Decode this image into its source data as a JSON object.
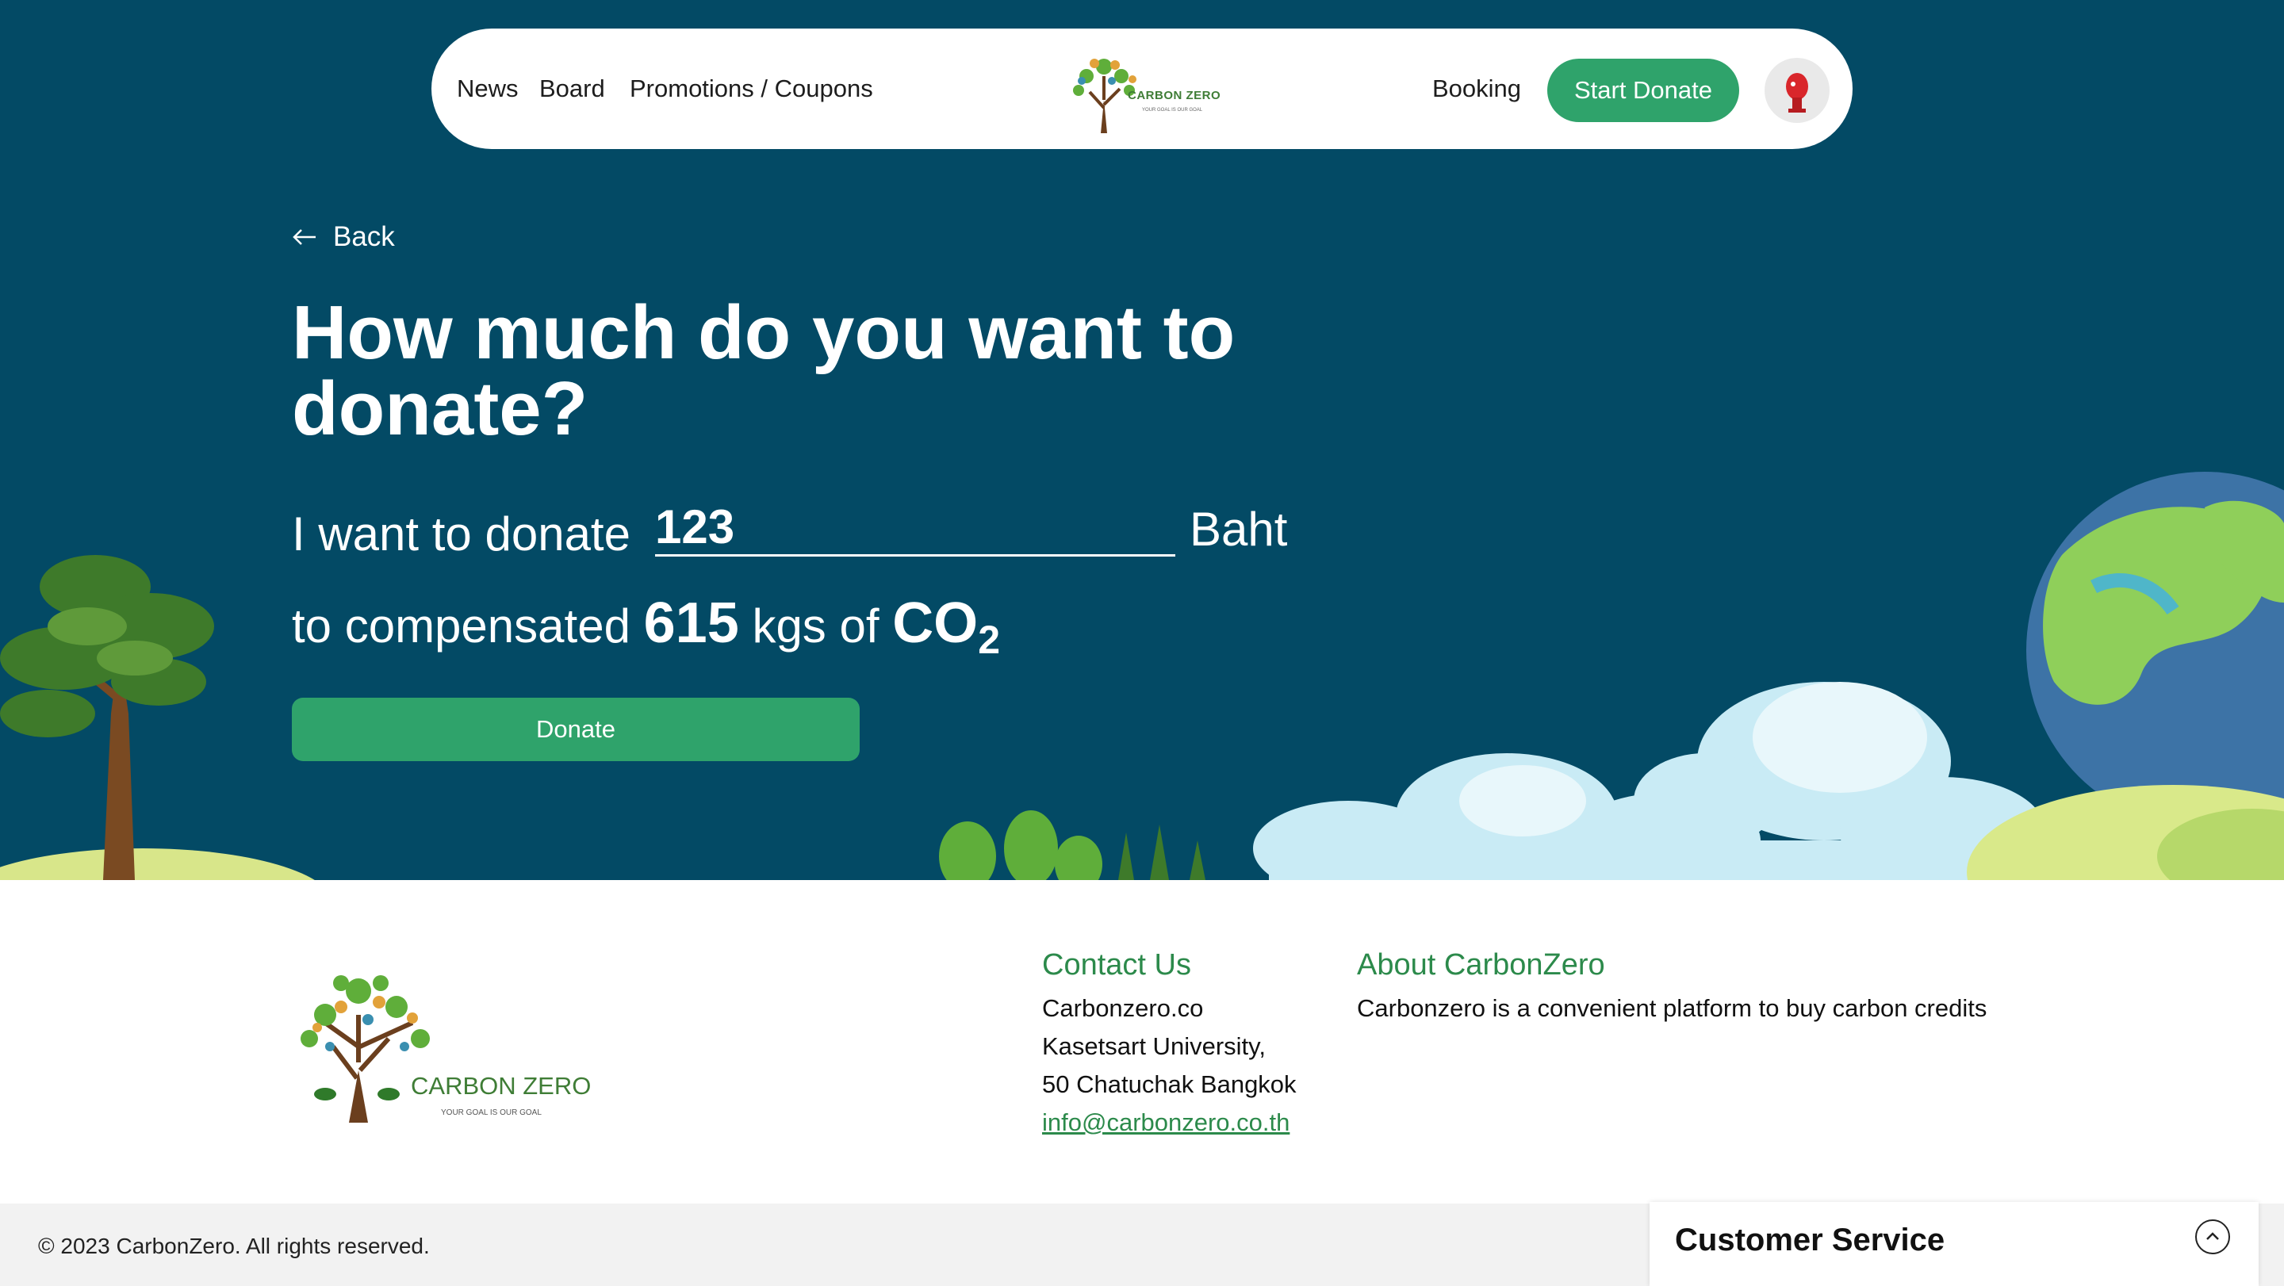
{
  "nav": {
    "links": [
      "News",
      "Board",
      "Promotions / Coupons"
    ],
    "logo_text": "CARBON ZERO",
    "logo_sub": "YOUR GOAL IS OUR GOAL",
    "booking": "Booking",
    "start_donate": "Start Donate"
  },
  "main": {
    "back": "Back",
    "title": "How much do you want to donate?",
    "donate_prefix": "I want to donate",
    "amount": "123",
    "currency": "Baht",
    "comp_prefix": "to compensated",
    "co2_amount": "615",
    "comp_unit": "kgs of",
    "co2_base": "CO",
    "co2_sub": "2",
    "donate_button": "Donate"
  },
  "footer": {
    "logo_text": "CARBON ZERO",
    "logo_sub": "YOUR GOAL IS OUR GOAL",
    "contact_title": "Contact Us",
    "contact_lines": [
      "Carbonzero.co",
      "Kasetsart University,",
      "50 Chatuchak Bangkok"
    ],
    "contact_email": "info@carbonzero.co.th",
    "about_title": "About CarbonZero",
    "about_text": "Carbonzero is a convenient platform to buy carbon credits",
    "copyright": "© 2023 CarbonZero. All rights reserved.",
    "customer_service": "Customer Service"
  },
  "colors": {
    "hero_bg": "#034a65",
    "accent_green": "#2fa36b",
    "link_green": "#2c8a4b"
  },
  "icons": [
    "back-arrow-icon",
    "tree-logo-icon",
    "avatar-icon",
    "chevron-up-icon"
  ]
}
